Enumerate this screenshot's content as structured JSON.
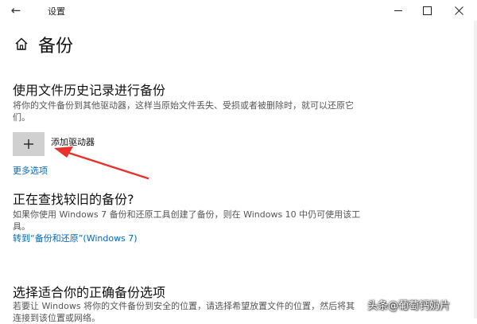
{
  "window": {
    "back_icon": "back-arrow-icon",
    "title": "设置"
  },
  "page": {
    "title": "备份",
    "icon": "home-icon"
  },
  "file_history": {
    "heading": "使用文件历史记录进行备份",
    "description": "将你的文件备份到其他驱动器，这样当原始文件丢失、受损或者被删除时，就可以还原它们。",
    "add_drive_label": "添加驱动器",
    "more_options": "更多选项"
  },
  "old_backup": {
    "heading": "正在查找较旧的备份?",
    "description": "如果你使用 Windows 7 备份和还原工具创建了备份，则在 Windows 10 中仍可使用该工具。",
    "link": "转到“备份和还原”(Windows 7)"
  },
  "choose_option": {
    "heading": "选择适合你的正确备份选项",
    "description": "若要让 Windows 将你的文件备份到安全的位置，请选择希望放置文件的位置，然后将其连接到该位置或网络。"
  },
  "watermark": "头条@葡萄钙奶片",
  "colors": {
    "link": "#0067c0",
    "arrow": "#e8312a",
    "button_bg": "#d0d0d0"
  }
}
